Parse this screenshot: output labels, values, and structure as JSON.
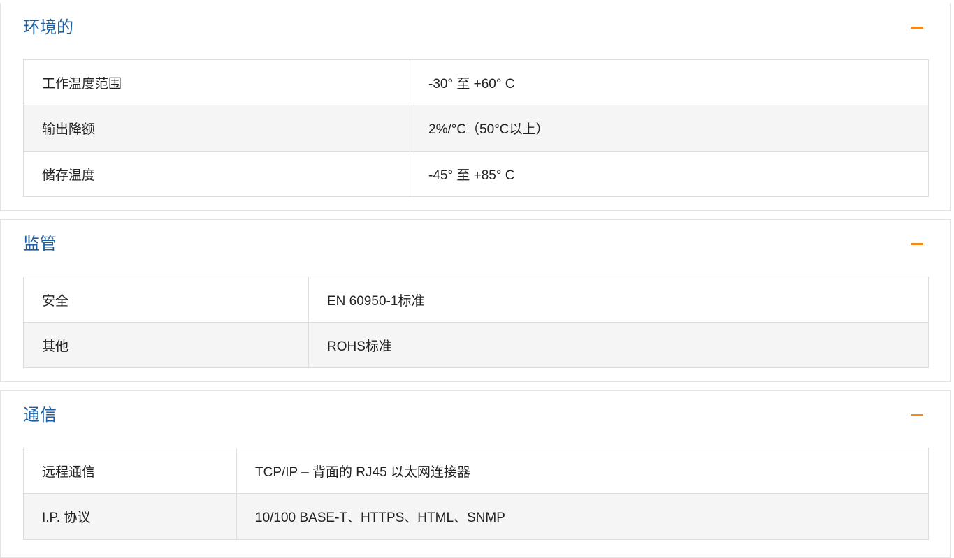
{
  "sections": [
    {
      "title": "环境的",
      "rows": [
        {
          "label": "工作温度范围",
          "value": "-30° 至 +60° C"
        },
        {
          "label": "输出降额",
          "value": "2%/°C（50°C以上）"
        },
        {
          "label": "储存温度",
          "value": "-45° 至 +85° C"
        }
      ]
    },
    {
      "title": "监管",
      "rows": [
        {
          "label": "安全",
          "value": "EN 60950-1标准"
        },
        {
          "label": "其他",
          "value": "ROHS标准"
        }
      ]
    },
    {
      "title": "通信",
      "rows": [
        {
          "label": "远程通信",
          "value": "TCP/IP – 背面的 RJ45 以太网连接器"
        },
        {
          "label": "I.P. 协议",
          "value": "10/100 BASE-T、HTTPS、HTML、SNMP"
        }
      ]
    }
  ],
  "colors": {
    "title": "#1d5fa0",
    "toggle": "#f08a1c",
    "alt_row": "#f5f5f5",
    "border": "#dddddd"
  },
  "icons": {
    "collapse": "minus-icon"
  }
}
